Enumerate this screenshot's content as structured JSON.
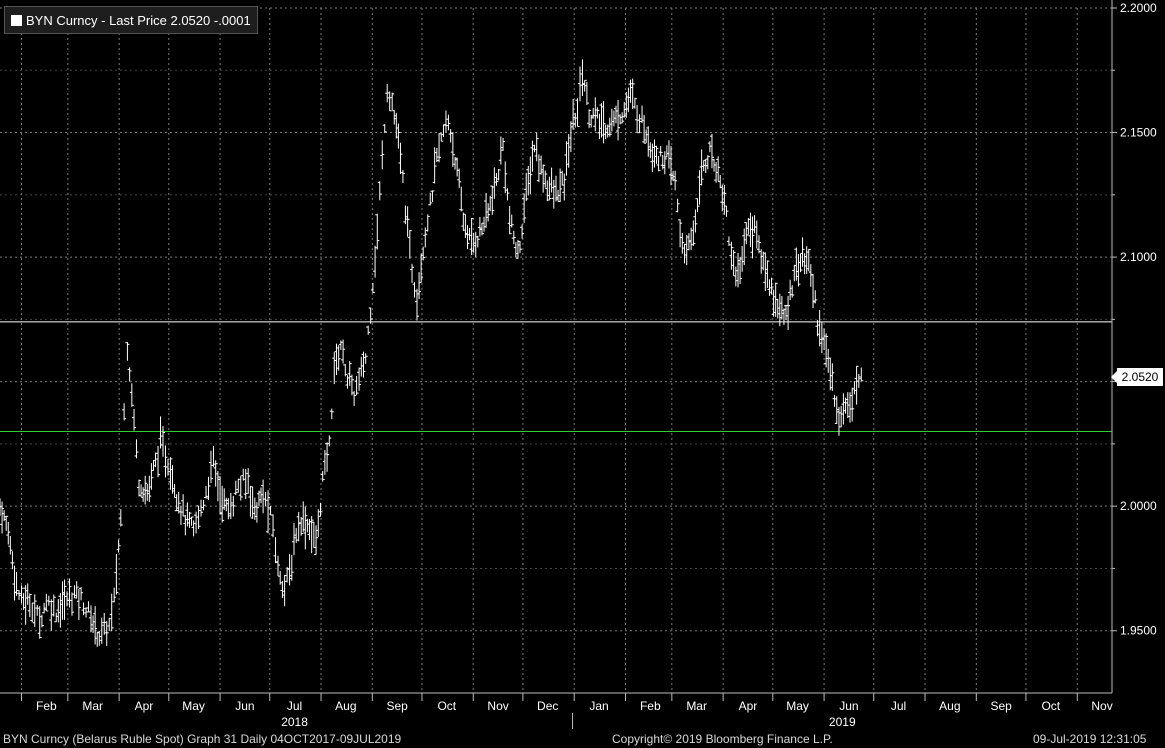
{
  "legend": {
    "swatch_color": "#ffffff",
    "text": "BYN Curncy - Last Price 2.0520  -.0001"
  },
  "last_price_tag": "2.0520",
  "footer": {
    "left": "BYN Curncy (Belarus Ruble Spot) Graph 31  Daily 04OCT2017-09JUL2019",
    "center": "Copyright© 2019 Bloomberg Finance L.P.",
    "right": "09-Jul-2019 12:31:05"
  },
  "colors": {
    "background": "#000000",
    "bars": "#ffffff",
    "grid": "#7a7a7a",
    "upper_line": "#ffffff",
    "lower_line": "#33cc33"
  },
  "chart_data": {
    "type": "line",
    "style": "ohlc-bars",
    "xlabel": "",
    "ylabel": "",
    "y_axis_position": "right",
    "ylim": [
      1.925,
      2.2
    ],
    "y_ticks": [
      "1.9500",
      "2.0000",
      "2.0500",
      "2.1000",
      "2.1500",
      "2.2000"
    ],
    "x_range": [
      "2018-01-19",
      "2019-11-22"
    ],
    "x_ticks": [
      {
        "label": "Feb",
        "date": "2018-02-01"
      },
      {
        "label": "Mar",
        "date": "2018-03-01"
      },
      {
        "label": "Apr",
        "date": "2018-04-01"
      },
      {
        "label": "May",
        "date": "2018-05-01"
      },
      {
        "label": "Jun",
        "date": "2018-06-01"
      },
      {
        "label": "Jul",
        "date": "2018-07-01"
      },
      {
        "label": "Aug",
        "date": "2018-08-01"
      },
      {
        "label": "Sep",
        "date": "2018-09-01"
      },
      {
        "label": "Oct",
        "date": "2018-10-01"
      },
      {
        "label": "Nov",
        "date": "2018-11-01"
      },
      {
        "label": "Dec",
        "date": "2018-12-01"
      },
      {
        "label": "Jan",
        "date": "2019-01-01"
      },
      {
        "label": "Feb",
        "date": "2019-02-01"
      },
      {
        "label": "Mar",
        "date": "2019-03-01"
      },
      {
        "label": "Apr",
        "date": "2019-04-01"
      },
      {
        "label": "May",
        "date": "2019-05-01"
      },
      {
        "label": "Jun",
        "date": "2019-06-01"
      },
      {
        "label": "Jul",
        "date": "2019-07-01"
      },
      {
        "label": "Aug",
        "date": "2019-08-01"
      },
      {
        "label": "Sep",
        "date": "2019-09-01"
      },
      {
        "label": "Oct",
        "date": "2019-10-01"
      },
      {
        "label": "Nov",
        "date": "2019-11-01"
      }
    ],
    "year_labels": [
      {
        "label": "2018",
        "date": "2018-07-16"
      },
      {
        "label": "2019",
        "date": "2019-06-12"
      }
    ],
    "year_divider": "2018-12-31",
    "horizontal_lines": [
      {
        "value": 2.074,
        "color": "#ffffff"
      },
      {
        "value": 2.03,
        "color": "#33cc33"
      }
    ],
    "last_price": 2.052,
    "grid": true,
    "series": [
      {
        "values_note": "",
        "points": [
          [
            "2018-01-19",
            2.0
          ],
          [
            "2018-01-24",
            1.99
          ],
          [
            "2018-01-29",
            1.968
          ],
          [
            "2018-02-01",
            1.962
          ],
          [
            "2018-02-06",
            1.962
          ],
          [
            "2018-02-12",
            1.954
          ],
          [
            "2018-02-16",
            1.962
          ],
          [
            "2018-02-22",
            1.958
          ],
          [
            "2018-02-27",
            1.962
          ],
          [
            "2018-03-05",
            1.965
          ],
          [
            "2018-03-09",
            1.963
          ],
          [
            "2018-03-15",
            1.955
          ],
          [
            "2018-03-20",
            1.948
          ],
          [
            "2018-03-26",
            1.952
          ],
          [
            "2018-03-29",
            1.962
          ],
          [
            "2018-04-02",
            1.995
          ],
          [
            "2018-04-04",
            2.04
          ],
          [
            "2018-04-06",
            2.065
          ],
          [
            "2018-04-10",
            2.035
          ],
          [
            "2018-04-13",
            2.01
          ],
          [
            "2018-04-18",
            2.005
          ],
          [
            "2018-04-23",
            2.018
          ],
          [
            "2018-04-26",
            2.025
          ],
          [
            "2018-05-02",
            2.015
          ],
          [
            "2018-05-07",
            2.002
          ],
          [
            "2018-05-11",
            1.995
          ],
          [
            "2018-05-16",
            1.99
          ],
          [
            "2018-05-22",
            2.002
          ],
          [
            "2018-05-28",
            2.018
          ],
          [
            "2018-06-01",
            2.005
          ],
          [
            "2018-06-06",
            1.998
          ],
          [
            "2018-06-12",
            2.008
          ],
          [
            "2018-06-18",
            2.01
          ],
          [
            "2018-06-22",
            1.998
          ],
          [
            "2018-06-27",
            2.005
          ],
          [
            "2018-07-03",
            1.992
          ],
          [
            "2018-07-06",
            1.975
          ],
          [
            "2018-07-10",
            1.968
          ],
          [
            "2018-07-13",
            1.972
          ],
          [
            "2018-07-17",
            1.99
          ],
          [
            "2018-07-20",
            1.995
          ],
          [
            "2018-07-25",
            1.992
          ],
          [
            "2018-07-29",
            1.985
          ],
          [
            "2018-08-02",
            2.01
          ],
          [
            "2018-08-06",
            2.025
          ],
          [
            "2018-08-09",
            2.055
          ],
          [
            "2018-08-13",
            2.065
          ],
          [
            "2018-08-17",
            2.052
          ],
          [
            "2018-08-21",
            2.045
          ],
          [
            "2018-08-24",
            2.05
          ],
          [
            "2018-08-28",
            2.06
          ],
          [
            "2018-08-31",
            2.08
          ],
          [
            "2018-09-04",
            2.11
          ],
          [
            "2018-09-07",
            2.14
          ],
          [
            "2018-09-10",
            2.168
          ],
          [
            "2018-09-13",
            2.162
          ],
          [
            "2018-09-18",
            2.14
          ],
          [
            "2018-09-21",
            2.12
          ],
          [
            "2018-09-25",
            2.095
          ],
          [
            "2018-09-28",
            2.085
          ],
          [
            "2018-10-03",
            2.11
          ],
          [
            "2018-10-06",
            2.12
          ],
          [
            "2018-10-10",
            2.14
          ],
          [
            "2018-10-14",
            2.15
          ],
          [
            "2018-10-17",
            2.155
          ],
          [
            "2018-10-21",
            2.14
          ],
          [
            "2018-10-26",
            2.115
          ],
          [
            "2018-10-31",
            2.105
          ],
          [
            "2018-11-05",
            2.11
          ],
          [
            "2018-11-10",
            2.118
          ],
          [
            "2018-11-15",
            2.13
          ],
          [
            "2018-11-19",
            2.145
          ],
          [
            "2018-11-23",
            2.115
          ],
          [
            "2018-11-28",
            2.1
          ],
          [
            "2018-12-03",
            2.125
          ],
          [
            "2018-12-08",
            2.145
          ],
          [
            "2018-12-12",
            2.135
          ],
          [
            "2018-12-17",
            2.128
          ],
          [
            "2018-12-21",
            2.125
          ],
          [
            "2018-12-26",
            2.13
          ],
          [
            "2018-12-30",
            2.15
          ],
          [
            "2019-01-03",
            2.16
          ],
          [
            "2019-01-06",
            2.175
          ],
          [
            "2019-01-10",
            2.158
          ],
          [
            "2019-01-15",
            2.155
          ],
          [
            "2019-01-20",
            2.152
          ],
          [
            "2019-01-25",
            2.155
          ],
          [
            "2019-01-30",
            2.158
          ],
          [
            "2019-02-04",
            2.165
          ],
          [
            "2019-02-08",
            2.158
          ],
          [
            "2019-02-11",
            2.155
          ],
          [
            "2019-02-16",
            2.145
          ],
          [
            "2019-02-21",
            2.14
          ],
          [
            "2019-02-26",
            2.14
          ],
          [
            "2019-03-03",
            2.13
          ],
          [
            "2019-03-06",
            2.11
          ],
          [
            "2019-03-10",
            2.1
          ],
          [
            "2019-03-14",
            2.11
          ],
          [
            "2019-03-19",
            2.135
          ],
          [
            "2019-03-24",
            2.142
          ],
          [
            "2019-03-29",
            2.135
          ],
          [
            "2019-04-03",
            2.118
          ],
          [
            "2019-04-06",
            2.1
          ],
          [
            "2019-04-10",
            2.092
          ],
          [
            "2019-04-15",
            2.11
          ],
          [
            "2019-04-20",
            2.112
          ],
          [
            "2019-04-24",
            2.1
          ],
          [
            "2019-04-29",
            2.09
          ],
          [
            "2019-05-04",
            2.08
          ],
          [
            "2019-05-09",
            2.075
          ],
          [
            "2019-05-14",
            2.095
          ],
          [
            "2019-05-19",
            2.1
          ],
          [
            "2019-05-24",
            2.095
          ],
          [
            "2019-05-28",
            2.075
          ],
          [
            "2019-06-01",
            2.065
          ],
          [
            "2019-06-06",
            2.05
          ],
          [
            "2019-06-10",
            2.035
          ],
          [
            "2019-06-14",
            2.04
          ],
          [
            "2019-06-18",
            2.045
          ],
          [
            "2019-06-22",
            2.05
          ],
          [
            "2019-06-25",
            2.052
          ]
        ]
      }
    ]
  }
}
